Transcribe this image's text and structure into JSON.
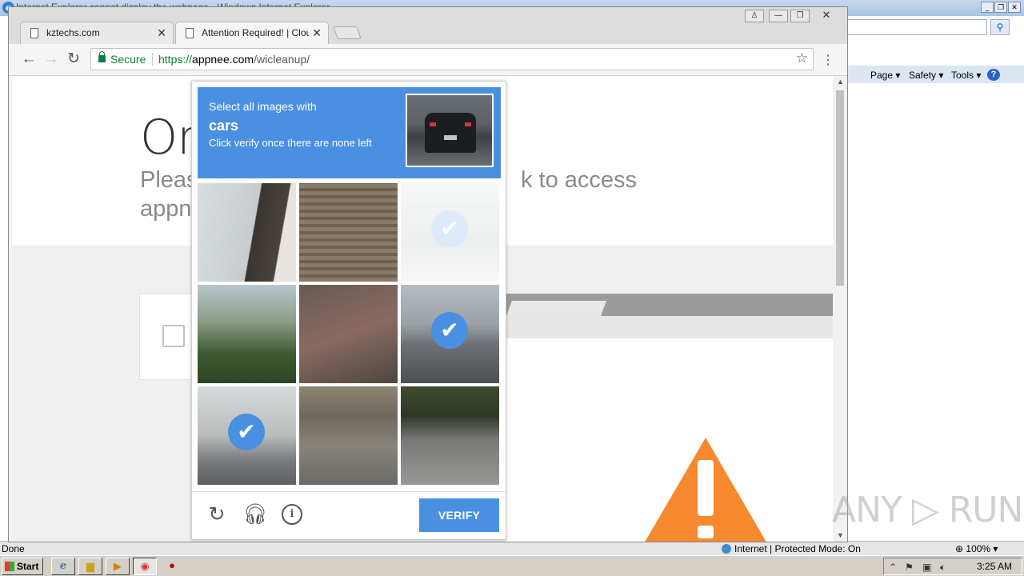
{
  "ie": {
    "title": "Internet Explorer cannot display the webpage - Windows Internet Explorer",
    "cmd_page": "Page ▾",
    "cmd_safety": "Safety ▾",
    "cmd_tools": "Tools ▾",
    "cmd_help": "?",
    "status_left": "Done",
    "status_zone": "Internet | Protected Mode: On",
    "status_zoom": "100%"
  },
  "chrome": {
    "tabs": [
      {
        "label": "kztechs.com"
      },
      {
        "label": "Attention Required! | Cloudfl"
      }
    ],
    "omnibox": {
      "secure": "Secure",
      "scheme": "https://",
      "host": "appnee.com",
      "path": "/wicleanup/"
    }
  },
  "page": {
    "title_fragment": "On",
    "sub1_start": "Pleas",
    "sub1_end": "k to access",
    "sub2_start": "appn"
  },
  "captcha": {
    "line1": "Select all images with",
    "keyword": "cars",
    "line3": "Click verify once there are none left",
    "verify_label": "VERIFY",
    "tiles": [
      {
        "selected": false,
        "faded": false
      },
      {
        "selected": false,
        "faded": false
      },
      {
        "selected": true,
        "faded": true
      },
      {
        "selected": false,
        "faded": false
      },
      {
        "selected": false,
        "faded": false
      },
      {
        "selected": true,
        "faded": false
      },
      {
        "selected": true,
        "faded": false
      },
      {
        "selected": false,
        "faded": false
      },
      {
        "selected": false,
        "faded": false
      }
    ]
  },
  "watermark": "ANY ▷ RUN",
  "taskbar": {
    "start_label": "Start",
    "clock": "3:25 AM"
  },
  "colors": {
    "recaptcha_blue": "#4a90e2",
    "secure_green": "#0b8043",
    "warning_orange": "#f6892e"
  }
}
